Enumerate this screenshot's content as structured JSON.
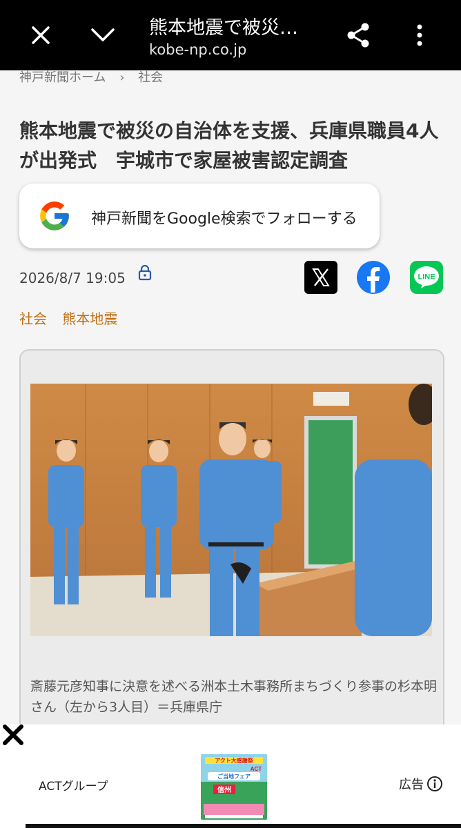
{
  "topbar": {
    "title": "熊本地震で被災…",
    "url": "kobe-np.co.jp",
    "icons": [
      "close-icon",
      "chevron-down-icon",
      "share-icon",
      "more-vert-icon"
    ]
  },
  "breadcrumb": {
    "home": "神戸新聞ホーム",
    "separator": "›",
    "section": "社会"
  },
  "article": {
    "headline": "熊本地震で被災の自治体を支援、兵庫県職員4人が出発式　宇城市で家屋被害認定調査",
    "date": "2026/8/7 19:05",
    "tags": [
      "社会",
      "熊本地震"
    ]
  },
  "follow": {
    "label": "神戸新聞をGoogle検索でフォローする"
  },
  "social": {
    "x": "X",
    "facebook": "f",
    "line": "LINE"
  },
  "photo": {
    "caption": "斎藤元彦知事に決意を述べる洲本土木事務所まちづくり参事の杉本明さん（左から3人目）＝兵庫県庁"
  },
  "ad": {
    "advertiser": "ACTグループ",
    "label": "広告",
    "banner_top": "アクト大感謝祭",
    "banner_mid": "ご当地フェア",
    "banner_act": "ACT",
    "banner_place": "信州"
  },
  "colors": {
    "tag": "#c36c10",
    "topbar": "#000000",
    "facebook": "#1877f2",
    "line": "#06c755"
  }
}
